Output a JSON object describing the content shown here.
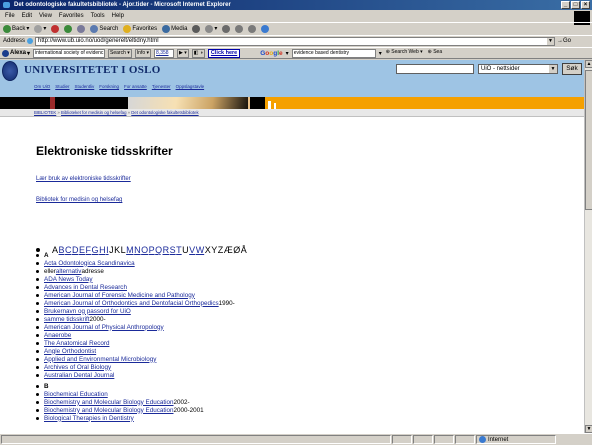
{
  "window": {
    "title": "Det odontologiske fakultetsbibliotek - Ajor.tider - Microsoft Internet Explorer"
  },
  "menu": [
    "File",
    "Edit",
    "View",
    "Favorites",
    "Tools",
    "Help"
  ],
  "toolbar": {
    "back": "Back",
    "search": "Search",
    "favorites": "Favorites",
    "media": "Media"
  },
  "address": {
    "label": "Address",
    "url": "http://www.ub.uio.no/uod/generelt/eltidny.html",
    "go": "Go"
  },
  "linksbar": {
    "alexa": "Alexa",
    "alexa_query": "international society of evidenc",
    "search_btn": "Search",
    "info": "Info",
    "rank": "8,358",
    "click_here": "Click here",
    "google": "Google",
    "google_query": "evidence based dentistry",
    "search_web": "Search Web",
    "search_site": "Sea"
  },
  "site": {
    "logo": "UNIVERSITETET I OSLO",
    "scope": "UiO - nettsider",
    "go": "Søk",
    "nav": [
      "Om UiO",
      "Studier",
      "Studentliv",
      "Forskning",
      "For ansatte",
      "Tjenester",
      "Oppslagstavle"
    ],
    "crumbs": [
      "BIBLIOTEK",
      "Biblioteket for medisin og helsefag",
      "Det odontologiske fakultetsbibliotek"
    ],
    "crumb_sep": "»"
  },
  "page": {
    "title": "Elektroniske tidsskrifter",
    "link1": "Lær bruk av elektroniske tidsskrifter",
    "link2": "Bibliotek for medisin og helsefag",
    "alphabet": [
      {
        "l": "A",
        "link": false
      },
      {
        "l": "B",
        "link": true
      },
      {
        "l": "C",
        "link": true
      },
      {
        "l": "D",
        "link": true
      },
      {
        "l": "E",
        "link": true
      },
      {
        "l": "F",
        "link": true
      },
      {
        "l": "G",
        "link": true
      },
      {
        "l": "H",
        "link": true
      },
      {
        "l": "I",
        "link": true
      },
      {
        "l": "J",
        "link": false
      },
      {
        "l": "K",
        "link": false
      },
      {
        "l": "L",
        "link": false
      },
      {
        "l": "M",
        "link": true
      },
      {
        "l": "N",
        "link": true
      },
      {
        "l": "O",
        "link": true
      },
      {
        "l": "P",
        "link": true
      },
      {
        "l": "Q",
        "link": true
      },
      {
        "l": "R",
        "link": true
      },
      {
        "l": "S",
        "link": true
      },
      {
        "l": "T",
        "link": true
      },
      {
        "l": "U",
        "link": false
      },
      {
        "l": "V",
        "link": true
      },
      {
        "l": "W",
        "link": true
      },
      {
        "l": "X",
        "link": false
      },
      {
        "l": "Y",
        "link": false
      },
      {
        "l": "Z",
        "link": false
      },
      {
        "l": "Æ",
        "link": false
      },
      {
        "l": "Ø",
        "link": false
      },
      {
        "l": "Å",
        "link": false
      }
    ],
    "section_a": [
      {
        "hdr": "A"
      },
      {
        "link": "Acta Odontologica Scandinavica"
      },
      {
        "pre": "eller ",
        "link": "alternativ",
        "post": " adresse"
      },
      {
        "link": "ADA News Today"
      },
      {
        "link": "Advances in Dental Research"
      },
      {
        "link": "American Journal of Forensic Medicine and Pathology"
      },
      {
        "link": "American Journal of Orthodontics and Dentofacial Orthopedics",
        "post": " 1990-"
      },
      {
        "link": "Brukernavn og passord for UiO"
      },
      {
        "link": "samme tidsskrift",
        "post": " 2000-"
      },
      {
        "link": "American Journal of Physical Anthropology"
      },
      {
        "link": "Anaerobe"
      },
      {
        "link": "The Anatomical Record"
      },
      {
        "link": "Angle Orthodontist"
      },
      {
        "link": "Applied and Environmental Microbiology"
      },
      {
        "link": "Archives of Oral Biology"
      },
      {
        "link": "Australian Dental Journal"
      }
    ],
    "section_b": [
      {
        "hdr": "B"
      },
      {
        "link": "Biochemical Education"
      },
      {
        "link": "Biochemistry and Molecular Biology Education",
        "post": " 2002-"
      },
      {
        "link": "Biochemistry and Molecular Biology Education",
        "post": " 2000-2001"
      },
      {
        "link": "Biological Therapies in Dentistry"
      }
    ]
  },
  "status": {
    "zone": "Internet"
  }
}
